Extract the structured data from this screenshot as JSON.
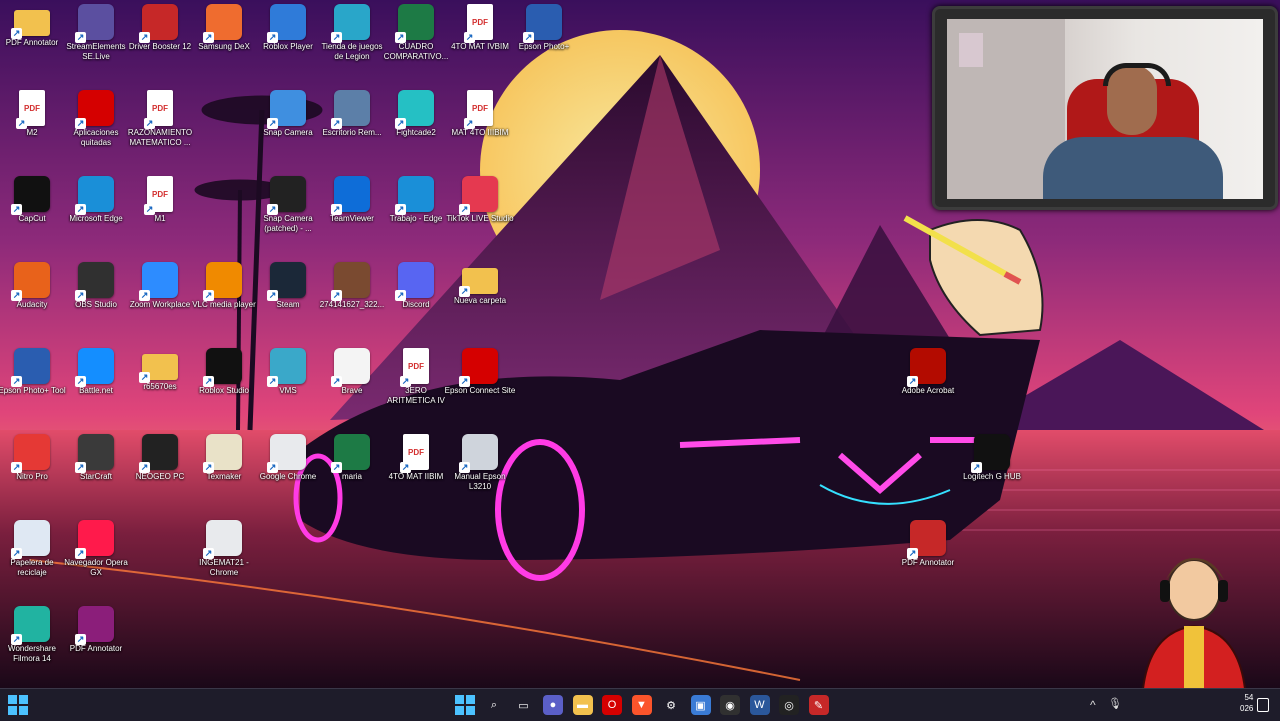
{
  "desktop_icons": [
    {
      "label": "PDF Annotator",
      "icon": "folder-icon",
      "color": "#f2c14e"
    },
    {
      "label": "StreamElements SE.Live",
      "icon": "streamelements-icon",
      "color": "#5b4fa0"
    },
    {
      "label": "Driver Booster 12",
      "icon": "driver-booster-icon",
      "color": "#c62828"
    },
    {
      "label": "Samsung DeX",
      "icon": "samsung-dex-icon",
      "color": "#ef6c2f"
    },
    {
      "label": "Roblox Player",
      "icon": "roblox-player-icon",
      "color": "#2f7bd9"
    },
    {
      "label": "Tienda de juegos de Legion",
      "icon": "legion-store-icon",
      "color": "#29a6c9"
    },
    {
      "label": "CUADRO COMPARATIVO...",
      "icon": "excel-icon",
      "color": "#1d7a45"
    },
    {
      "label": "4TO MAT IVBIM",
      "icon": "pdf-icon",
      "color": "#d32f2f"
    },
    {
      "label": "Epson Photo+",
      "icon": "epson-photo-icon",
      "color": "#2a5db0"
    },
    {
      "label": "M2",
      "icon": "pdf-icon",
      "color": "#d32f2f"
    },
    {
      "label": "Aplicaciones quitadas",
      "icon": "opera-icon",
      "color": "#d50000"
    },
    {
      "label": "RAZONAMIENTO MATEMATICO ...",
      "icon": "pdf-icon",
      "color": "#d32f2f"
    },
    {
      "label": "Snap Camera",
      "icon": "snap-camera-icon",
      "color": "#3f8fe0"
    },
    {
      "label": "Escritorio Rem...",
      "icon": "remote-desktop-icon",
      "color": "#5c7fa8"
    },
    {
      "label": "Fightcade2",
      "icon": "fightcade-icon",
      "color": "#25c0c4"
    },
    {
      "label": "MAT 4TO IIIBIM",
      "icon": "pdf-icon",
      "color": "#d32f2f"
    },
    {
      "label": "CapCut",
      "icon": "capcut-icon",
      "color": "#111111"
    },
    {
      "label": "Microsoft Edge",
      "icon": "edge-icon",
      "color": "#1a8fd8"
    },
    {
      "label": "M1",
      "icon": "pdf-icon",
      "color": "#d32f2f"
    },
    {
      "label": "Snap Camera (patched) - ...",
      "icon": "snap-camera-patched-icon",
      "color": "#222222"
    },
    {
      "label": "TeamViewer",
      "icon": "teamviewer-icon",
      "color": "#0e6dd8"
    },
    {
      "label": "Trabajo - Edge",
      "icon": "edge-work-icon",
      "color": "#1a8fd8"
    },
    {
      "label": "TikTok LIVE Studio",
      "icon": "tiktok-icon",
      "color": "#e53950"
    },
    {
      "label": "Audacity",
      "icon": "audacity-icon",
      "color": "#e8621b"
    },
    {
      "label": "OBS Studio",
      "icon": "obs-icon",
      "color": "#303030"
    },
    {
      "label": "Zoom Workplace",
      "icon": "zoom-icon",
      "color": "#2d8cff"
    },
    {
      "label": "VLC media player",
      "icon": "vlc-icon",
      "color": "#f08a00"
    },
    {
      "label": "Steam",
      "icon": "steam-icon",
      "color": "#1b2838"
    },
    {
      "label": "274141627_322...",
      "icon": "image-file-icon",
      "color": "#7a4a30"
    },
    {
      "label": "Discord",
      "icon": "discord-icon",
      "color": "#5865f2"
    },
    {
      "label": "Nueva carpeta",
      "icon": "folder-icon",
      "color": "#f2c14e"
    },
    {
      "label": "Epson Photo+ Tool",
      "icon": "epson-tool-icon",
      "color": "#2a5db0"
    },
    {
      "label": "Battle.net",
      "icon": "battlenet-icon",
      "color": "#148eff"
    },
    {
      "label": "r65670es",
      "icon": "folder-icon",
      "color": "#f2c14e"
    },
    {
      "label": "Roblox Studio",
      "icon": "roblox-studio-icon",
      "color": "#111111"
    },
    {
      "label": "VMS",
      "icon": "vms-icon",
      "color": "#3aa8c9"
    },
    {
      "label": "Brave",
      "icon": "file-icon",
      "color": "#f4f4f4"
    },
    {
      "label": "3ERO ARITMETICA IV",
      "icon": "pdf-icon",
      "color": "#d32f2f"
    },
    {
      "label": "Epson Connect Site",
      "icon": "opera-icon",
      "color": "#d50000"
    },
    {
      "label": "Adobe Acrobat",
      "icon": "acrobat-icon",
      "color": "#b30b00"
    },
    {
      "label": "Nitro Pro",
      "icon": "nitro-icon",
      "color": "#e53935"
    },
    {
      "label": "StarCraft",
      "icon": "starcraft-icon",
      "color": "#3a3a3a"
    },
    {
      "label": "NEOGEO PC",
      "icon": "neogeo-icon",
      "color": "#222222"
    },
    {
      "label": "Texmaker",
      "icon": "texmaker-icon",
      "color": "#e9e2c8"
    },
    {
      "label": "Google Chrome",
      "icon": "chrome-icon",
      "color": "#e8eaed"
    },
    {
      "label": "maria",
      "icon": "excel-icon",
      "color": "#1d7a45"
    },
    {
      "label": "4TO MAT IIBIM",
      "icon": "pdf-icon",
      "color": "#d32f2f"
    },
    {
      "label": "Manual Epson L3210",
      "icon": "manual-icon",
      "color": "#cfd4dc"
    },
    {
      "label": "Logitech G HUB",
      "icon": "logitech-icon",
      "color": "#111111"
    },
    {
      "label": "Papelera de reciclaje",
      "icon": "recycle-bin-icon",
      "color": "#dfe8f3"
    },
    {
      "label": "Navegador Opera GX",
      "icon": "opera-gx-icon",
      "color": "#ff1a4b"
    },
    {
      "label": "INGEMAT21 - Chrome",
      "icon": "chrome-profile-icon",
      "color": "#e8eaed"
    },
    {
      "label": "PDF Annotator",
      "icon": "pdf-annotator-icon",
      "color": "#c62828"
    },
    {
      "label": "Wondershare Filmora 14",
      "icon": "filmora-icon",
      "color": "#21b3a1"
    },
    {
      "label": "PDF Annotator",
      "icon": "winrar-icon",
      "color": "#8b1e7a"
    }
  ],
  "taskbar": {
    "start_label": "Start",
    "apps": [
      {
        "name": "search",
        "glyph": "⌕",
        "color": "transparent"
      },
      {
        "name": "task-view",
        "glyph": "▭",
        "color": "transparent"
      },
      {
        "name": "video-call",
        "glyph": "●",
        "color": "#5b5fc7"
      },
      {
        "name": "file-explorer",
        "glyph": "▬",
        "color": "#f2c14e"
      },
      {
        "name": "opera",
        "glyph": "O",
        "color": "#d50000"
      },
      {
        "name": "brave",
        "glyph": "▼",
        "color": "#fb542b"
      },
      {
        "name": "settings",
        "glyph": "⚙",
        "color": "transparent"
      },
      {
        "name": "photos",
        "glyph": "▣",
        "color": "#3a7bd5"
      },
      {
        "name": "obs",
        "glyph": "◉",
        "color": "#303030"
      },
      {
        "name": "word",
        "glyph": "W",
        "color": "#2b579a"
      },
      {
        "name": "snap-camera",
        "glyph": "◎",
        "color": "#222222"
      },
      {
        "name": "pdf-annotator",
        "glyph": "✎",
        "color": "#c62828"
      }
    ],
    "tray": {
      "chevron": "^",
      "mic": "🎙",
      "time": "54",
      "date": "026"
    }
  }
}
